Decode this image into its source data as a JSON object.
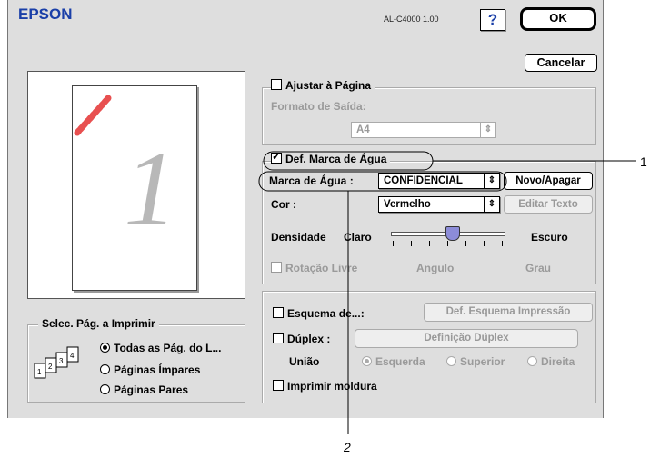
{
  "header": {
    "brand": "EPSON",
    "model": "AL-C4000  1.00",
    "help_label": "?",
    "ok_label": "OK",
    "cancel_label": "Cancelar"
  },
  "preview": {
    "page_number": "1"
  },
  "paper": {
    "fit_label": "Ajustar à Página",
    "output_label": "Formato de Saída:",
    "output_value": "A4"
  },
  "watermark": {
    "enable_label": "Def. Marca de Água",
    "mark_label": "Marca de Água :",
    "mark_value": "CONFIDENCIAL",
    "new_delete_label": "Novo/Apagar",
    "color_label": "Cor :",
    "color_value": "Vermelho",
    "edit_text_label": "Editar Texto",
    "density_label": "Densidade",
    "density_light": "Claro",
    "density_dark": "Escuro",
    "density_level": 0.55,
    "rotation_label": "Rotação Livre",
    "angle_label": "Angulo",
    "degree_label": "Grau"
  },
  "layout": {
    "scheme_label": "Esquema de...:",
    "scheme_button": "Def. Esquema Impressão",
    "duplex_label": "Dúplex :",
    "duplex_button": "Definição Dúplex",
    "binding_label": "União",
    "binding_options": [
      "Esquerda",
      "Superior",
      "Direita"
    ],
    "frame_label": "Imprimir moldura"
  },
  "page_select": {
    "title": "Selec. Pág. a Imprimir",
    "options": [
      "Todas as Pág. do L...",
      "Páginas Ímpares",
      "Páginas Pares"
    ]
  },
  "callouts": {
    "one": "1",
    "two": "2"
  },
  "colors": {
    "brand": "#1a3fa8",
    "dialog_bg": "#dedede",
    "stroke": "#e85050"
  }
}
